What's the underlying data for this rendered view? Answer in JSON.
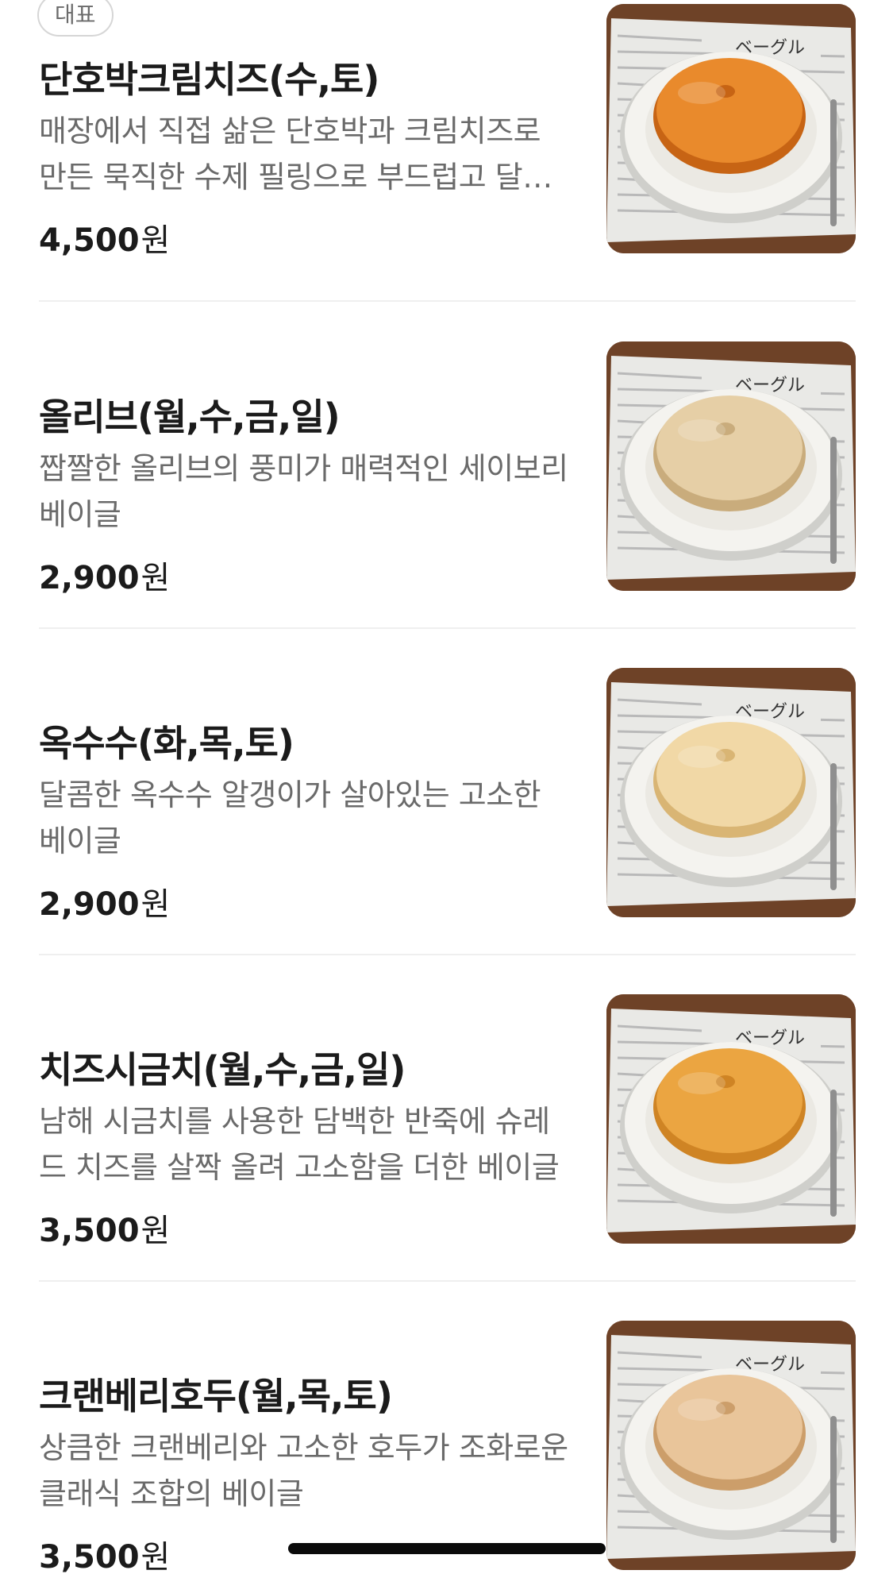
{
  "menu": {
    "items": [
      {
        "badge": "대표",
        "name": "단호박크림치즈(수,토)",
        "desc": "매장에서 직접 삶은 단호박과 크림치즈로 만든 묵직한 수제 필링으로 부드럽고 달콤한 베이글",
        "price": "4,500",
        "currency": "원",
        "bagel_color": "#e98a2c",
        "bagel_shade": "#c76414",
        "image": "pumpkin-bagel-photo"
      },
      {
        "name": "올리브(월,수,금,일)",
        "desc": "짭짤한 올리브의 풍미가 매력적인 세이보리 베이글",
        "price": "2,900",
        "currency": "원",
        "bagel_color": "#e6cfa6",
        "bagel_shade": "#c9ac7c",
        "image": "olive-bagel-photo"
      },
      {
        "name": "옥수수(화,목,토)",
        "desc": "달콤한 옥수수 알갱이가 살아있는 고소한 베이글",
        "price": "2,900",
        "currency": "원",
        "bagel_color": "#f1d8a6",
        "bagel_shade": "#d9b574",
        "image": "corn-bagel-photo"
      },
      {
        "name": "치즈시금치(월,수,금,일)",
        "desc": "남해 시금치를 사용한 담백한 반죽에 슈레드 치즈를 살짝 올려 고소함을 더한 베이글",
        "price": "3,500",
        "currency": "원",
        "bagel_color": "#eba541",
        "bagel_shade": "#cf8424",
        "image": "cheese-spinach-bagel-photo"
      },
      {
        "name": "크랜베리호두(월,목,토)",
        "desc": "상큼한 크랜베리와 고소한 호두가 조화로운 클래식 조합의 베이글",
        "price": "3,500",
        "currency": "원",
        "bagel_color": "#e9c59a",
        "bagel_shade": "#cc9e6a",
        "image": "cranberry-walnut-bagel-photo"
      }
    ]
  }
}
